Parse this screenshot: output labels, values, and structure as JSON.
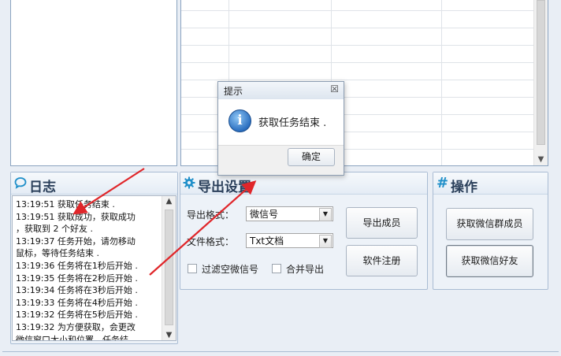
{
  "log_panel": {
    "title": "日志",
    "icon": "chat-bubble-icon",
    "lines": [
      "13:19:51  获取任务结束 .",
      "13:19:51  获取成功，获取成功",
      "，获取到 2 个好友 .",
      "13:19:37  任务开始，请勿移动",
      "鼠标，等待任务结束 .",
      "13:19:36  任务将在1秒后开始 .",
      "13:19:35  任务将在2秒后开始 .",
      "13:19:34  任务将在3秒后开始 .",
      "13:19:33  任务将在4秒后开始 .",
      "13:19:32  任务将在5秒后开始 .",
      "13:19:32  为方便获取，会更改",
      "微信窗口大小和位置，任务结"
    ]
  },
  "export_panel": {
    "title": "导出设置",
    "icon": "gear-icon",
    "format_label": "导出格式：",
    "format_value": "微信号",
    "file_format_label": "文件格式：",
    "file_format_value": "Txt文档",
    "filter_empty_label": "过滤空微信号",
    "merge_export_label": "合并导出",
    "export_members_button": "导出成员",
    "register_button": "软件注册"
  },
  "operation_panel": {
    "title": "操作",
    "icon": "hash-icon",
    "get_group_members_button": "获取微信群成员",
    "get_friends_button": "获取微信好友"
  },
  "dialog": {
    "title": "提示",
    "message": "获取任务结束 .",
    "ok_button": "确定",
    "icon": "info-icon"
  },
  "colors": {
    "accent": "#1f8fc9",
    "arrow": "#e0262a",
    "panel_bg": "#edf2f8"
  }
}
